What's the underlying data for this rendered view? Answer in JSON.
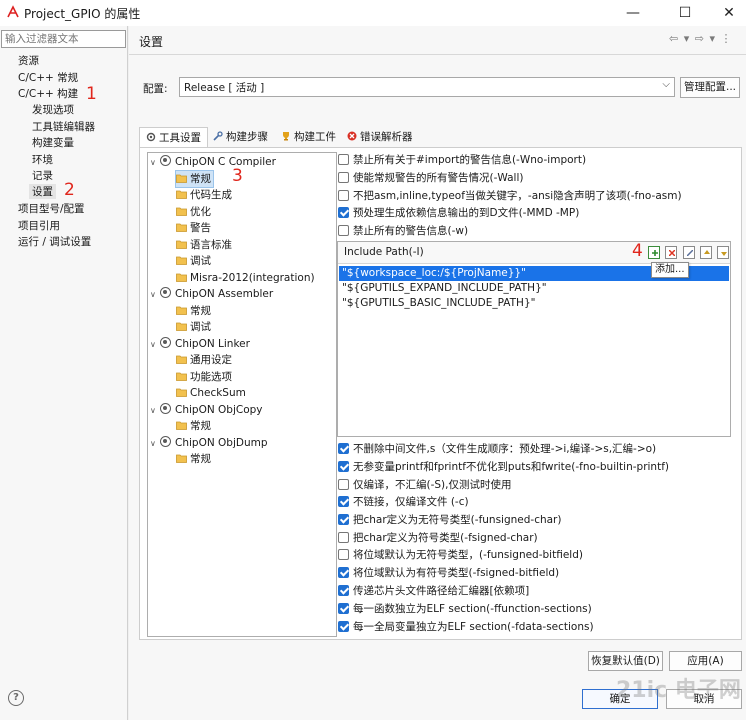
{
  "window": {
    "title": "Project_GPIO 的属性",
    "minimize": "—",
    "maximize": "☐",
    "close": "✕"
  },
  "left": {
    "filter_placeholder": "输入过滤器文本",
    "items": [
      {
        "label": "资源"
      },
      {
        "label": "C/C++ 常规"
      },
      {
        "label": "C/C++ 构建"
      },
      {
        "label": "发现选项"
      },
      {
        "label": "工具链编辑器"
      },
      {
        "label": "构建变量"
      },
      {
        "label": "环境"
      },
      {
        "label": "记录"
      },
      {
        "label": "设置"
      },
      {
        "label": "项目型号/配置"
      },
      {
        "label": "项目引用"
      },
      {
        "label": "运行 / 调试设置"
      }
    ]
  },
  "annotations": {
    "m1": "1",
    "m2": "2",
    "m3": "3",
    "m4": "4"
  },
  "right": {
    "title": "设置",
    "nav_arrows": "⇦ ▾ ⇨ ▾ ⋮",
    "config_label": "配置:",
    "config_value": "Release  [ 活动 ]",
    "manage_button": "管理配置...",
    "tabs": [
      {
        "label": "工具设置"
      },
      {
        "label": "构建步骤"
      },
      {
        "label": "构建工件"
      },
      {
        "label": "错误解析器"
      }
    ]
  },
  "tree": {
    "items": [
      {
        "label": "ChipON C Compiler"
      },
      {
        "label": "常规"
      },
      {
        "label": "代码生成"
      },
      {
        "label": "优化"
      },
      {
        "label": "警告"
      },
      {
        "label": "语言标准"
      },
      {
        "label": "调试"
      },
      {
        "label": "Misra-2012(integration)"
      },
      {
        "label": "ChipON Assembler"
      },
      {
        "label": "常规"
      },
      {
        "label": "调试"
      },
      {
        "label": "ChipON Linker"
      },
      {
        "label": "通用设定"
      },
      {
        "label": "功能选项"
      },
      {
        "label": "CheckSum"
      },
      {
        "label": "ChipON ObjCopy"
      },
      {
        "label": "常规"
      },
      {
        "label": "ChipON ObjDump"
      },
      {
        "label": "常规"
      }
    ]
  },
  "options_top": [
    {
      "label": "禁止所有关于#import的警告信息(-Wno-import)",
      "checked": false
    },
    {
      "label": "使能常规警告的所有警告情况(-Wall)",
      "checked": false
    },
    {
      "label": "不把asm,inline,typeof当做关键字，-ansi隐含声明了该项(-fno-asm)",
      "checked": false
    },
    {
      "label": "预处理生成依赖信息输出的到D文件(-MMD -MP)",
      "checked": true
    },
    {
      "label": "禁止所有的警告信息(-w)",
      "checked": false
    }
  ],
  "include": {
    "title": "Include Path(-I)",
    "tooltip": "添加...",
    "paths": [
      "\"${workspace_loc:/${ProjName}}\"",
      "\"${GPUTILS_EXPAND_INCLUDE_PATH}\"",
      "\"${GPUTILS_BASIC_INCLUDE_PATH}\""
    ]
  },
  "options_bottom": [
    {
      "label": "不删除中间文件,s（文件生成顺序：预处理->i,编译->s,汇编->o)",
      "checked": true
    },
    {
      "label": "无参变量printf和fprintf不优化到puts和fwrite(-fno-builtin-printf)",
      "checked": true
    },
    {
      "label": "仅编译，不汇编(-S),仅测试时使用",
      "checked": false
    },
    {
      "label": "不链接，仅编译文件 (-c)",
      "checked": true
    },
    {
      "label": "把char定义为无符号类型(-funsigned-char)",
      "checked": true
    },
    {
      "label": "把char定义为符号类型(-fsigned-char)",
      "checked": false
    },
    {
      "label": "将位域默认为无符号类型，(-funsigned-bitfield)",
      "checked": false
    },
    {
      "label": "将位域默认为有符号类型(-fsigned-bitfield)",
      "checked": true
    },
    {
      "label": "传递芯片头文件路径给汇编器[依赖项]",
      "checked": true
    },
    {
      "label": "每一函数独立为ELF section(-ffunction-sections)",
      "checked": true
    },
    {
      "label": "每一全局变量独立为ELF section(-fdata-sections)",
      "checked": true
    }
  ],
  "buttons": {
    "restore_defaults": "恢复默认值(D)",
    "apply": "应用(A)",
    "ok": "确定",
    "cancel": "取消"
  },
  "help_glyph": "?",
  "watermark": "21ic 电子网",
  "colors": {
    "accent": "#1a73e8",
    "annotation": "#e0261c",
    "checkbox_on": "#1f6fd1"
  }
}
